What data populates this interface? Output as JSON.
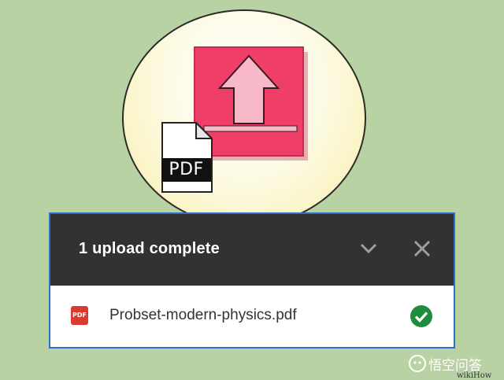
{
  "illustration": {
    "doc_label": "PDF",
    "colors": {
      "upload_box": "#ef3e67",
      "arrow_fill": "#f7b9c8",
      "circle_fill": "#fbf3c2",
      "background": "#b9d2a3"
    }
  },
  "upload_panel": {
    "title": "1 upload complete",
    "collapse_icon": "chevron-down-icon",
    "close_icon": "close-icon",
    "file": {
      "type_badge": "PDF",
      "name": "Probset-modern-physics.pdf",
      "status_icon": "check-circle-icon",
      "status_color": "#1e8e3e"
    },
    "colors": {
      "header": "#323232",
      "border": "#2f6fbf"
    }
  },
  "watermark": {
    "text": "悟空问答",
    "brand": "wikiHow"
  }
}
